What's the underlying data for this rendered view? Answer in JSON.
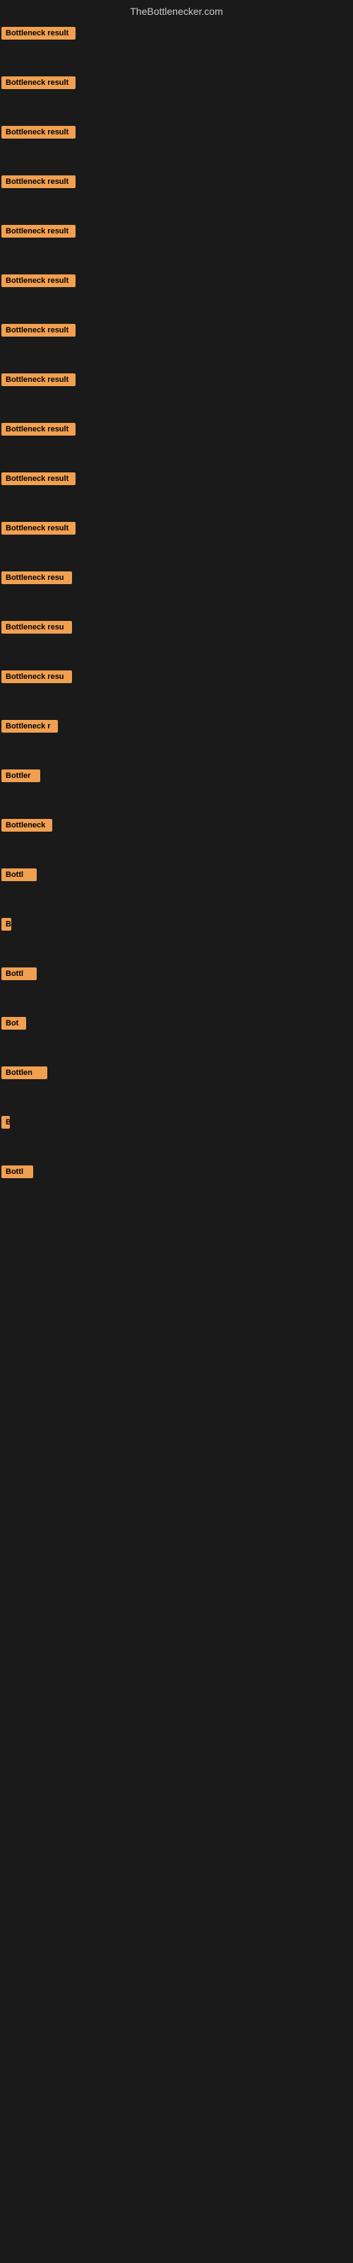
{
  "header": {
    "site_name": "TheBottlenecker.com"
  },
  "items": [
    {
      "id": 1,
      "label": "Bottleneck result",
      "row_class": "row-1"
    },
    {
      "id": 2,
      "label": "Bottleneck result",
      "row_class": "row-2"
    },
    {
      "id": 3,
      "label": "Bottleneck result",
      "row_class": "row-3"
    },
    {
      "id": 4,
      "label": "Bottleneck result",
      "row_class": "row-4"
    },
    {
      "id": 5,
      "label": "Bottleneck result",
      "row_class": "row-5"
    },
    {
      "id": 6,
      "label": "Bottleneck result",
      "row_class": "row-6"
    },
    {
      "id": 7,
      "label": "Bottleneck result",
      "row_class": "row-7"
    },
    {
      "id": 8,
      "label": "Bottleneck result",
      "row_class": "row-8"
    },
    {
      "id": 9,
      "label": "Bottleneck result",
      "row_class": "row-9"
    },
    {
      "id": 10,
      "label": "Bottleneck result",
      "row_class": "row-10"
    },
    {
      "id": 11,
      "label": "Bottleneck result",
      "row_class": "row-11"
    },
    {
      "id": 12,
      "label": "Bottleneck resu",
      "row_class": "row-12"
    },
    {
      "id": 13,
      "label": "Bottleneck resu",
      "row_class": "row-13"
    },
    {
      "id": 14,
      "label": "Bottleneck resu",
      "row_class": "row-14"
    },
    {
      "id": 15,
      "label": "Bottleneck r",
      "row_class": "row-15"
    },
    {
      "id": 16,
      "label": "Bottler",
      "row_class": "row-16"
    },
    {
      "id": 17,
      "label": "Bottleneck",
      "row_class": "row-17"
    },
    {
      "id": 18,
      "label": "Bottl",
      "row_class": "row-18"
    },
    {
      "id": 19,
      "label": "B",
      "row_class": "row-19"
    },
    {
      "id": 20,
      "label": "Bottl",
      "row_class": "row-20"
    },
    {
      "id": 21,
      "label": "Bot",
      "row_class": "row-21"
    },
    {
      "id": 22,
      "label": "Bottlen",
      "row_class": "row-22"
    },
    {
      "id": 23,
      "label": "B",
      "row_class": "row-23"
    },
    {
      "id": 24,
      "label": "Bottl",
      "row_class": "row-24"
    }
  ]
}
